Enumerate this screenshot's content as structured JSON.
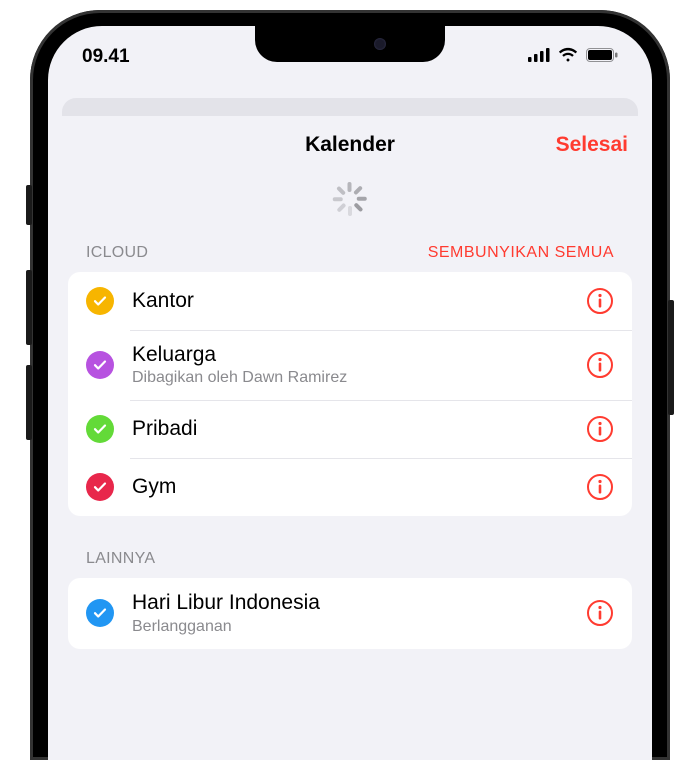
{
  "status": {
    "time": "09.41"
  },
  "header": {
    "title": "Kalender",
    "done": "Selesai"
  },
  "sections": [
    {
      "label": "ICLOUD",
      "hide_all": "SEMBUNYIKAN SEMUA",
      "items": [
        {
          "title": "Kantor",
          "subtitle": "",
          "color": "#f7b500"
        },
        {
          "title": "Keluarga",
          "subtitle": "Dibagikan oleh Dawn Ramirez",
          "color": "#b752e0"
        },
        {
          "title": "Pribadi",
          "subtitle": "",
          "color": "#63da38"
        },
        {
          "title": "Gym",
          "subtitle": "",
          "color": "#e8274b"
        }
      ]
    },
    {
      "label": "LAINNYA",
      "hide_all": "",
      "items": [
        {
          "title": "Hari Libur Indonesia",
          "subtitle": "Berlangganan",
          "color": "#2196f3"
        }
      ]
    }
  ],
  "colors": {
    "accent": "#ff3b30"
  }
}
